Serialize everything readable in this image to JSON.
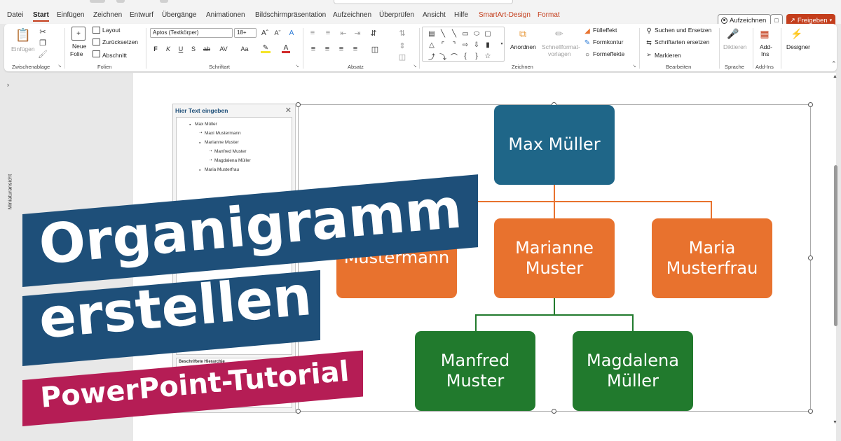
{
  "tabs": [
    {
      "label": "Datei"
    },
    {
      "label": "Start",
      "active": true
    },
    {
      "label": "Einfügen"
    },
    {
      "label": "Zeichnen"
    },
    {
      "label": "Entwurf"
    },
    {
      "label": "Übergänge"
    },
    {
      "label": "Animationen"
    },
    {
      "label": "Bildschirmpräsentation"
    },
    {
      "label": "Aufzeichnen"
    },
    {
      "label": "Überprüfen"
    },
    {
      "label": "Ansicht"
    },
    {
      "label": "Hilfe"
    },
    {
      "label": "SmartArt-Design",
      "contextual": true
    },
    {
      "label": "Format",
      "contextual": true
    }
  ],
  "header_buttons": {
    "record": "Aufzeichnen",
    "share": "Freigeben"
  },
  "ribbon": {
    "clipboard": {
      "paste": "Einfügen",
      "group": "Zwischenablage"
    },
    "slides": {
      "new_slide_1": "Neue",
      "new_slide_2": "Folie",
      "layout": "Layout",
      "reset": "Zurücksetzen",
      "section": "Abschnitt",
      "group": "Folien"
    },
    "font": {
      "font_name": "Aptos (Textkörper)",
      "font_size": "18+",
      "group": "Schriftart"
    },
    "paragraph": {
      "group": "Absatz"
    },
    "drawing": {
      "arrange": "Anordnen",
      "quick_styles_1": "Schnellformat-",
      "quick_styles_2": "vorlagen",
      "fill": "Fülleffekt",
      "outline": "Formkontur",
      "effects": "Formeffekte",
      "group": "Zeichnen"
    },
    "editing": {
      "find": "Suchen und Ersetzen",
      "replace_fonts": "Schriftarten ersetzen",
      "select": "Markieren",
      "group": "Bearbeiten"
    },
    "voice": {
      "dictate": "Diktieren",
      "group": "Sprache"
    },
    "addins": {
      "label_1": "Add-",
      "label_2": "Ins",
      "group": "Add-Ins"
    },
    "designer": {
      "label": "Designer"
    }
  },
  "thumbnail_pane": {
    "label": "Miniaturansicht"
  },
  "text_pane": {
    "title": "Hier Text eingeben",
    "items": [
      {
        "text": "Max Müller",
        "level": 1
      },
      {
        "text": "Maxi Mustermann",
        "level": 2
      },
      {
        "text": "Marianne Muster",
        "level": 2
      },
      {
        "text": "Manfred Muster",
        "level": 3
      },
      {
        "text": "Magdalena Müller",
        "level": 3
      },
      {
        "text": "Maria Musterfrau",
        "level": 2
      }
    ],
    "description_label": "Beschriftete Hierarchie"
  },
  "org_chart": {
    "root": {
      "line1": "Max Müller"
    },
    "level2": [
      {
        "line1": "",
        "line2": "Mustermann"
      },
      {
        "line1": "Marianne",
        "line2": "Muster"
      },
      {
        "line1": "Maria",
        "line2": "Musterfrau"
      }
    ],
    "level3": [
      {
        "line1": "Manfred",
        "line2": "Muster"
      },
      {
        "line1": "Magdalena",
        "line2": "Müller"
      }
    ],
    "colors": {
      "root": "#1f6688",
      "level2": "#e8722e",
      "level3": "#217a2d",
      "banner_blue": "#1e4f79",
      "banner_red": "#b51d55",
      "accent": "#c43e1c"
    }
  },
  "overlay": {
    "line1": "Organigramm",
    "line2": "erstellen",
    "subtitle": "PowerPoint-Tutorial"
  }
}
